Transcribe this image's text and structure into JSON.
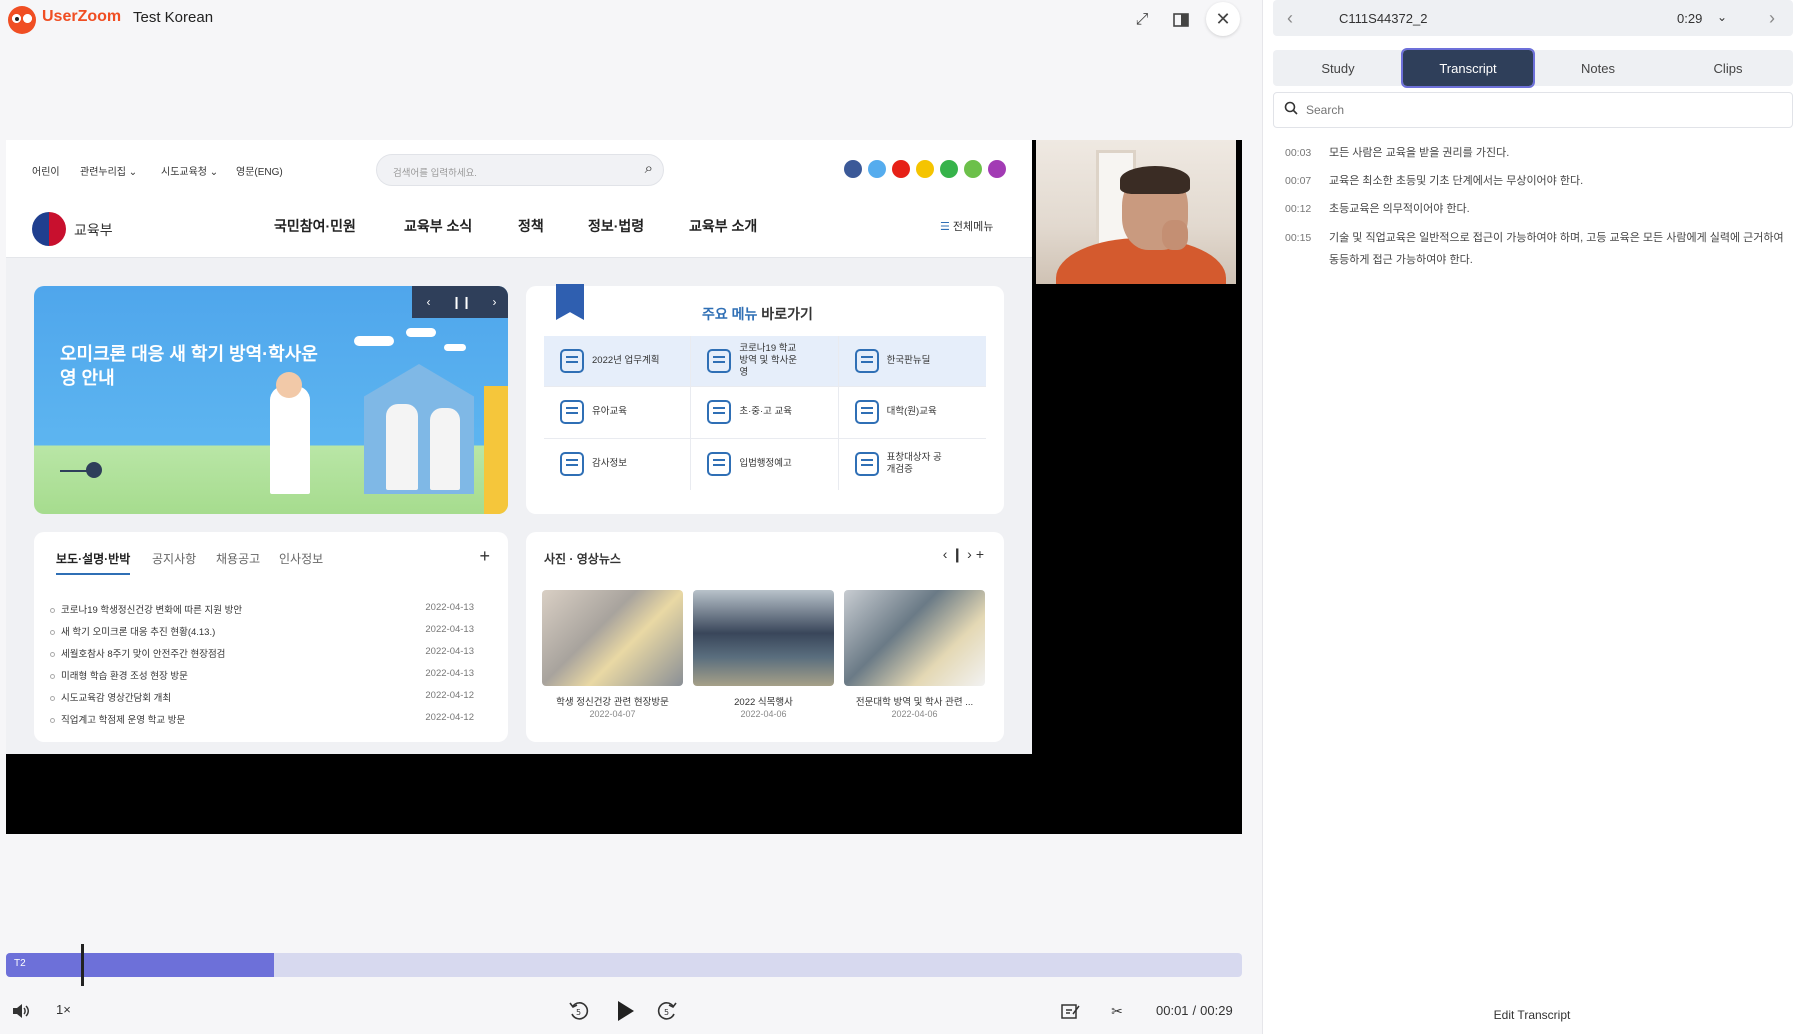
{
  "header": {
    "brand": "UserZoom",
    "project_title": "Test Korean"
  },
  "video": {
    "site": {
      "top_links": [
        "어린이",
        "관련누리집 ⌄",
        "시도교육청 ⌄",
        "영문(ENG)"
      ],
      "search_placeholder": "검색어를 입력하세요.",
      "logo_text": "교육부",
      "nav": [
        "국민참여·민원",
        "교육부 소식",
        "정책",
        "정보·법령",
        "교육부 소개"
      ],
      "all_menu": "전체메뉴",
      "banner_title": "오미크론 대응 새 학기 방역·학사운영 안내",
      "quick_title_accent": "주요 메뉴",
      "quick_title_rest": " 바로가기",
      "quick_items": [
        "2022년 업무계획",
        "코로나19 학교방역 및 학사운영",
        "한국판뉴딜",
        "유아교육",
        "초·중·고 교육",
        "대학(원)교육",
        "감사정보",
        "입법행정예고",
        "표창대상자 공개검증"
      ],
      "news_tabs": [
        "보도·설명·반박",
        "공지사항",
        "채용공고",
        "인사정보"
      ],
      "news": [
        {
          "title": "코로나19 학생정신건강 변화에 따른 지원 방안",
          "date": "2022-04-13"
        },
        {
          "title": "새 학기 오미크론 대응 추진 현황(4.13.)",
          "date": "2022-04-13"
        },
        {
          "title": "세월호참사 8주기 맞이 안전주간 현장점검",
          "date": "2022-04-13"
        },
        {
          "title": "미래형 학습 환경 조성 현장 방문",
          "date": "2022-04-13"
        },
        {
          "title": "시도교육감 영상간담회 개최",
          "date": "2022-04-12"
        },
        {
          "title": "직업계고 학점제 운영 학교 방문",
          "date": "2022-04-12"
        }
      ],
      "photo_title": "사진 · 영상뉴스",
      "photos": [
        {
          "caption": "학생 정신건강 관련 현장방문",
          "date": "2022-04-07"
        },
        {
          "caption": "2022 식목행사",
          "date": "2022-04-06"
        },
        {
          "caption": "전문대학 방역 및 학사 관련 ...",
          "date": "2022-04-06"
        }
      ]
    }
  },
  "timeline": {
    "label": "T2",
    "played_fraction": 0.217
  },
  "controls": {
    "speed": "1×",
    "current_time": "00:01",
    "separator": "/",
    "total_time": "00:29"
  },
  "right": {
    "session_id": "C111S44372_2",
    "duration": "0:29",
    "tabs": [
      "Study",
      "Transcript",
      "Notes",
      "Clips"
    ],
    "active_tab": "Transcript",
    "search_placeholder": "Search",
    "transcript": [
      {
        "time": "00:03",
        "text": "모든 사람은 교육을 받을 권리를 가진다."
      },
      {
        "time": "00:07",
        "text": "교육은 최소한 초등및 기초 단계에서는 무상이어야 한다."
      },
      {
        "time": "00:12",
        "text": "초등교육은 의무적이어야 한다."
      },
      {
        "time": "00:15",
        "text": "기술 및 직업교육은 일반적으로 접근이 가능하여야 하며, 고등 교육은 모든 사람에게 실력에 근거하여 동등하게 접근 가능하여야 한다."
      }
    ],
    "edit_label": "Edit Transcript"
  }
}
